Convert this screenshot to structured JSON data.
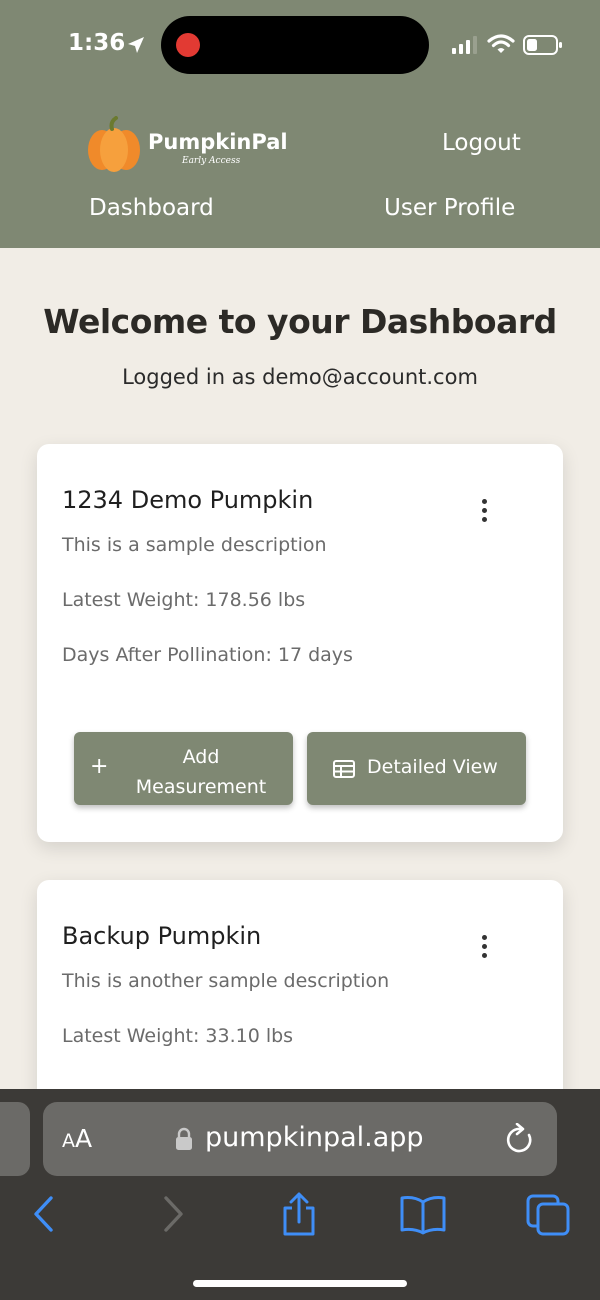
{
  "status_bar": {
    "time": "1:36"
  },
  "header": {
    "brand_name": "PumpkinPal",
    "brand_tag": "Early Access",
    "logout": "Logout",
    "dashboard": "Dashboard",
    "user_profile": "User Profile"
  },
  "main": {
    "title": "Welcome to your Dashboard",
    "logged_in": "Logged in as demo@account.com",
    "cards": [
      {
        "title": "1234 Demo Pumpkin",
        "description": "This is a sample description",
        "latest_weight": "Latest Weight: 178.56 lbs",
        "days_after_pollination": "Days After Pollination: 17 days",
        "add_measurement_line1": "Add",
        "add_measurement_line2": "Measurement",
        "add_icon": "+",
        "detailed_view": "Detailed View"
      },
      {
        "title": "Backup Pumpkin",
        "description": "This is another sample description",
        "latest_weight": "Latest Weight: 33.10 lbs"
      }
    ]
  },
  "browser": {
    "aa_label_small": "A",
    "aa_label_large": "A",
    "url": "pumpkinpal.app"
  },
  "colors": {
    "header_bg": "#7f8873",
    "page_bg": "#f1ede6",
    "button_bg": "#7f8873",
    "safari_bar": "#3c3a37",
    "link_blue": "#3f8ef7"
  }
}
